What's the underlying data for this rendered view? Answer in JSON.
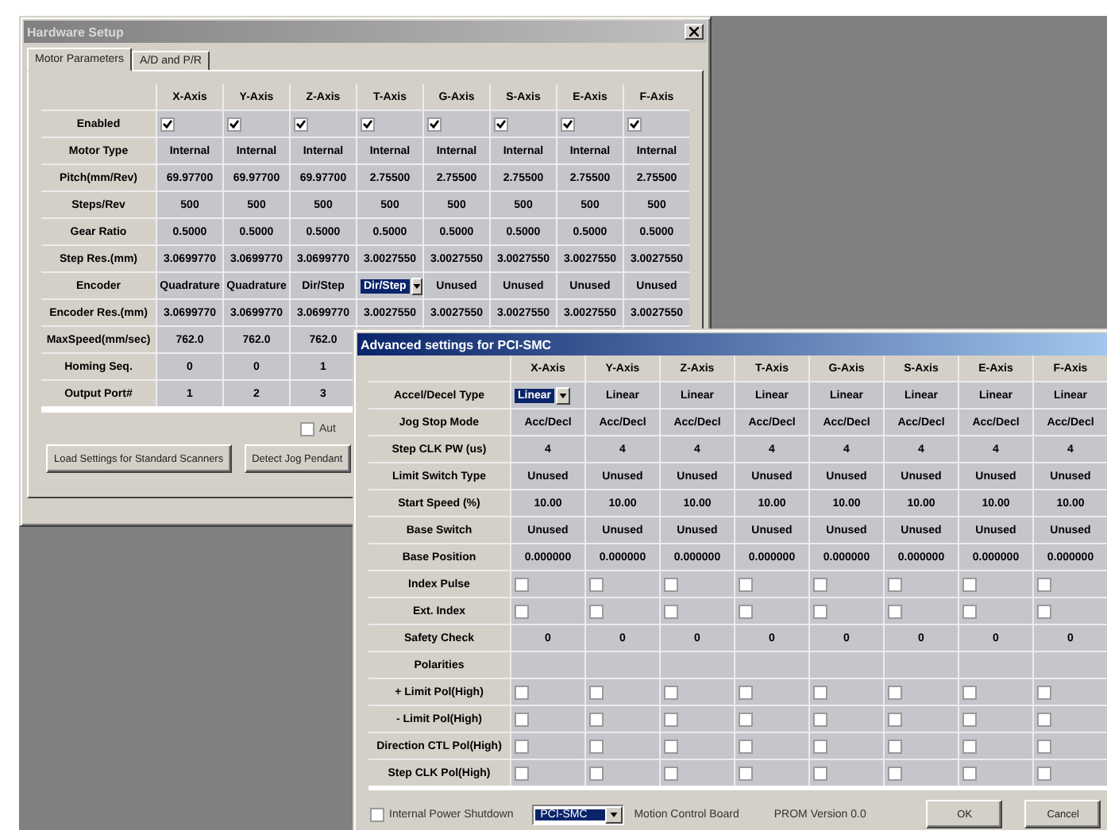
{
  "hardware_setup": {
    "title": "Hardware Setup",
    "active": false,
    "tabs": [
      {
        "label": "Motor Parameters",
        "selected": true
      },
      {
        "label": "A/D and P/R",
        "selected": false
      }
    ],
    "grid": {
      "columns": [
        "X-Axis",
        "Y-Axis",
        "Z-Axis",
        "T-Axis",
        "G-Axis",
        "S-Axis",
        "E-Axis",
        "F-Axis"
      ],
      "rows": [
        {
          "label": "Enabled",
          "kind": "check",
          "cells": [
            {
              "checked": true
            },
            {
              "checked": true
            },
            {
              "checked": true
            },
            {
              "checked": true
            },
            {
              "checked": true
            },
            {
              "checked": true
            },
            {
              "checked": true
            },
            {
              "checked": true
            }
          ]
        },
        {
          "label": "Motor Type",
          "kind": "text",
          "cells": [
            "Internal",
            "Internal",
            "Internal",
            "Internal",
            "Internal",
            "Internal",
            "Internal",
            "Internal"
          ]
        },
        {
          "label": "Pitch(mm/Rev)",
          "kind": "text",
          "cells": [
            "69.97700",
            "69.97700",
            "69.97700",
            "2.75500",
            "2.75500",
            "2.75500",
            "2.75500",
            "2.75500"
          ]
        },
        {
          "label": "Steps/Rev",
          "kind": "text",
          "cells": [
            "500",
            "500",
            "500",
            "500",
            "500",
            "500",
            "500",
            "500"
          ]
        },
        {
          "label": "Gear Ratio",
          "kind": "text",
          "cells": [
            "0.5000",
            "0.5000",
            "0.5000",
            "0.5000",
            "0.5000",
            "0.5000",
            "0.5000",
            "0.5000"
          ]
        },
        {
          "label": "Step Res.(mm)",
          "kind": "text",
          "cells": [
            "3.0699770",
            "3.0699770",
            "3.0699770",
            "3.0027550",
            "3.0027550",
            "3.0027550",
            "3.0027550",
            "3.0027550"
          ]
        },
        {
          "label": "Encoder",
          "kind": "select",
          "cells": [
            {
              "value": "Quadrature",
              "selected": false
            },
            {
              "value": "Quadrature",
              "selected": false
            },
            {
              "value": "Dir/Step",
              "selected": false
            },
            {
              "value": "Dir/Step",
              "selected": true
            },
            {
              "value": "Unused",
              "selected": false
            },
            {
              "value": "Unused",
              "selected": false
            },
            {
              "value": "Unused",
              "selected": false
            },
            {
              "value": "Unused",
              "selected": false
            }
          ]
        },
        {
          "label": "Encoder Res.(mm)",
          "kind": "text",
          "cells": [
            "3.0699770",
            "3.0699770",
            "3.0699770",
            "3.0027550",
            "3.0027550",
            "3.0027550",
            "3.0027550",
            "3.0027550"
          ]
        },
        {
          "label": "MaxSpeed(mm/sec)",
          "kind": "text",
          "cells": [
            "762.0",
            "762.0",
            "762.0"
          ]
        },
        {
          "label": "Homing Seq.",
          "kind": "text",
          "cells": [
            "0",
            "0",
            "1"
          ]
        },
        {
          "label": "Output Port#",
          "kind": "text",
          "cells": [
            "1",
            "2",
            "3"
          ]
        }
      ]
    },
    "auto_checkbox": {
      "label": "Aut",
      "checked": false
    },
    "buttons": [
      "Load Settings for Standard Scanners",
      "Detect Jog Pendant"
    ]
  },
  "advanced_settings": {
    "title": "Advanced settings for PCI-SMC",
    "active": true,
    "grid": {
      "columns": [
        "X-Axis",
        "Y-Axis",
        "Z-Axis",
        "T-Axis",
        "G-Axis",
        "S-Axis",
        "E-Axis",
        "F-Axis"
      ],
      "rows": [
        {
          "label": "Accel/Decel Type",
          "kind": "select",
          "cells": [
            {
              "value": "Linear",
              "selected": true
            },
            {
              "value": "Linear",
              "selected": false
            },
            {
              "value": "Linear",
              "selected": false
            },
            {
              "value": "Linear",
              "selected": false
            },
            {
              "value": "Linear",
              "selected": false
            },
            {
              "value": "Linear",
              "selected": false
            },
            {
              "value": "Linear",
              "selected": false
            },
            {
              "value": "Linear",
              "selected": false
            }
          ]
        },
        {
          "label": "Jog Stop Mode",
          "kind": "text",
          "cells": [
            "Acc/Decl",
            "Acc/Decl",
            "Acc/Decl",
            "Acc/Decl",
            "Acc/Decl",
            "Acc/Decl",
            "Acc/Decl",
            "Acc/Decl"
          ]
        },
        {
          "label": "Step CLK PW (us)",
          "kind": "text",
          "cells": [
            "4",
            "4",
            "4",
            "4",
            "4",
            "4",
            "4",
            "4"
          ]
        },
        {
          "label": "Limit Switch Type",
          "kind": "text",
          "cells": [
            "Unused",
            "Unused",
            "Unused",
            "Unused",
            "Unused",
            "Unused",
            "Unused",
            "Unused"
          ]
        },
        {
          "label": "Start Speed (%)",
          "kind": "text",
          "cells": [
            "10.00",
            "10.00",
            "10.00",
            "10.00",
            "10.00",
            "10.00",
            "10.00",
            "10.00"
          ]
        },
        {
          "label": "Base Switch",
          "kind": "text",
          "cells": [
            "Unused",
            "Unused",
            "Unused",
            "Unused",
            "Unused",
            "Unused",
            "Unused",
            "Unused"
          ]
        },
        {
          "label": "Base Position",
          "kind": "text",
          "cells": [
            "0.000000",
            "0.000000",
            "0.000000",
            "0.000000",
            "0.000000",
            "0.000000",
            "0.000000",
            "0.000000"
          ]
        },
        {
          "label": "Index Pulse",
          "kind": "check",
          "cells": [
            {
              "checked": false
            },
            {
              "checked": false
            },
            {
              "checked": false
            },
            {
              "checked": false
            },
            {
              "checked": false
            },
            {
              "checked": false
            },
            {
              "checked": false
            },
            {
              "checked": false
            }
          ]
        },
        {
          "label": "Ext. Index",
          "kind": "check",
          "cells": [
            {
              "checked": false
            },
            {
              "checked": false
            },
            {
              "checked": false
            },
            {
              "checked": false
            },
            {
              "checked": false
            },
            {
              "checked": false
            },
            {
              "checked": false
            },
            {
              "checked": false
            }
          ]
        },
        {
          "label": "Safety Check",
          "kind": "text",
          "cells": [
            "0",
            "0",
            "0",
            "0",
            "0",
            "0",
            "0",
            "0"
          ]
        },
        {
          "label": "Polarities",
          "kind": "heading"
        },
        {
          "label": "+ Limit Pol(High)",
          "kind": "check",
          "cells": [
            {
              "checked": false
            },
            {
              "checked": false
            },
            {
              "checked": false
            },
            {
              "checked": false
            },
            {
              "checked": false
            },
            {
              "checked": false
            },
            {
              "checked": false
            },
            {
              "checked": false
            }
          ]
        },
        {
          "label": "- Limit Pol(High)",
          "kind": "check",
          "cells": [
            {
              "checked": false
            },
            {
              "checked": false
            },
            {
              "checked": false
            },
            {
              "checked": false
            },
            {
              "checked": false
            },
            {
              "checked": false
            },
            {
              "checked": false
            },
            {
              "checked": false
            }
          ]
        },
        {
          "label": "Direction CTL Pol(High)",
          "kind": "check",
          "cells": [
            {
              "checked": false
            },
            {
              "checked": false
            },
            {
              "checked": false
            },
            {
              "checked": false
            },
            {
              "checked": false
            },
            {
              "checked": false
            },
            {
              "checked": false
            },
            {
              "checked": false
            }
          ]
        },
        {
          "label": "Step CLK Pol(High)",
          "kind": "check",
          "cells": [
            {
              "checked": false
            },
            {
              "checked": false
            },
            {
              "checked": false
            },
            {
              "checked": false
            },
            {
              "checked": false
            },
            {
              "checked": false
            },
            {
              "checked": false
            },
            {
              "checked": false
            }
          ]
        }
      ]
    },
    "power_shutdown": {
      "label": "Internal Power Shutdown",
      "checked": false
    },
    "board_select": {
      "value": "PCI-SMC",
      "caption": "Motion Control Board"
    },
    "prom_version": "PROM Version 0.0",
    "buttons": [
      "OK",
      "Cancel"
    ]
  }
}
